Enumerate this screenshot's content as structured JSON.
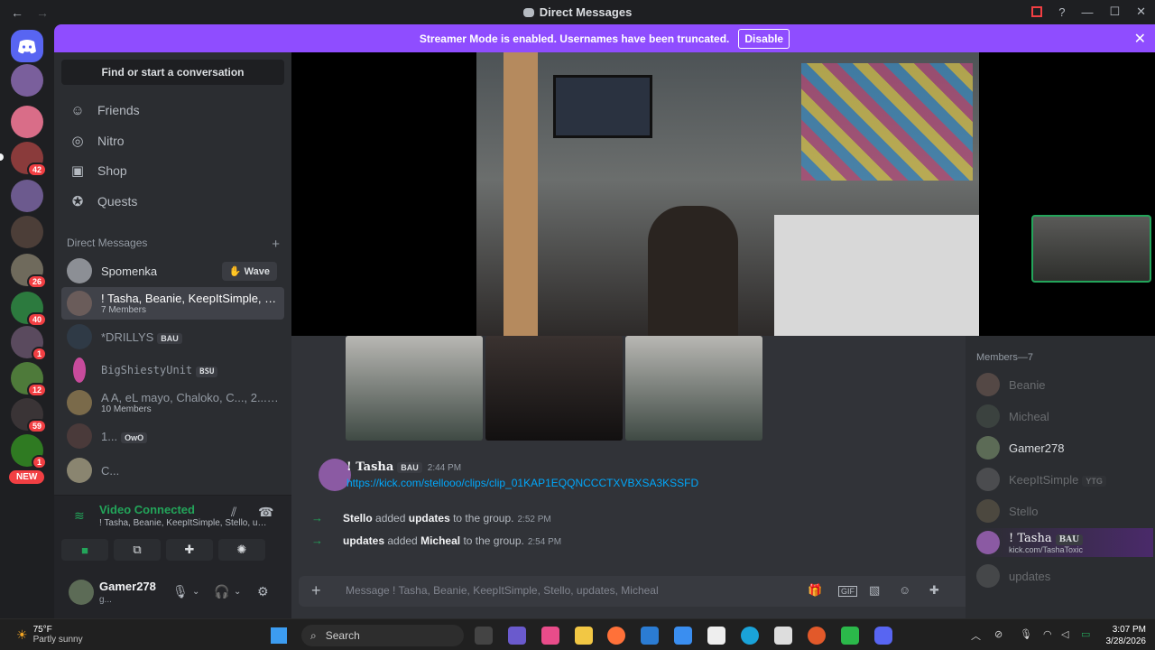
{
  "titlebar": {
    "title": "Direct Messages",
    "back": "←",
    "forward": "→"
  },
  "streamer": {
    "message": "Streamer Mode is enabled. Usernames have been truncated.",
    "disable_label": "Disable",
    "close": "✕"
  },
  "rail": {
    "badges": [
      "42",
      "26",
      "40",
      "1",
      "12",
      "59",
      "1"
    ],
    "new_label": "NEW"
  },
  "sidebar": {
    "find_label": "Find or start a conversation",
    "nav": [
      {
        "label": "Friends",
        "icon": "☺"
      },
      {
        "label": "Nitro",
        "icon": "◎"
      },
      {
        "label": "Shop",
        "icon": "▣"
      },
      {
        "label": "Quests",
        "icon": "✪"
      }
    ],
    "dm_header": "Direct Messages",
    "dm_add": "+",
    "dms": [
      {
        "name": "Spomenka",
        "sub": "",
        "tag": "",
        "wave": "Wave"
      },
      {
        "name": "! Tasha, Beanie, KeepItSimple, St...",
        "sub": "7 Members",
        "tag": ""
      },
      {
        "name": "*DRILLYS",
        "sub": "",
        "tag": "BAU"
      },
      {
        "name": "BigShiestyUnit",
        "sub": "",
        "tag": "BSU"
      },
      {
        "name": "A A, eL mayo, Chaloko, C..., 2..., ...",
        "sub": "10 Members",
        "tag": ""
      },
      {
        "name": "1...",
        "sub": "",
        "tag": "OwO"
      },
      {
        "name": "C...",
        "sub": "",
        "tag": ""
      }
    ]
  },
  "voice": {
    "title": "Video Connected",
    "subtitle": "! Tasha, Beanie, KeepItSimple, Stello, upd..."
  },
  "user": {
    "name": "Gamer278",
    "status": "g..."
  },
  "chat": {
    "message": {
      "author": "! Tasha",
      "tag": "BAU",
      "time": "2:44 PM",
      "link": "https://kick.com/stellooo/clips/clip_01KAP1EQQNCCCTXVBXSA3KSSFD"
    },
    "system": [
      {
        "actor": "Stello",
        "verb": "added",
        "target": "updates",
        "suffix": "to the group.",
        "time": "2:52 PM"
      },
      {
        "actor": "updates",
        "verb": "added",
        "target": "Micheal",
        "suffix": "to the group.",
        "time": "2:54 PM"
      }
    ],
    "composer_placeholder": "Message ! Tasha, Beanie, KeepItSimple, Stello, updates, Micheal"
  },
  "members": {
    "header": "Members—7",
    "list": [
      {
        "name": "Beanie",
        "sub": "",
        "tag": ""
      },
      {
        "name": "Micheal",
        "sub": "",
        "tag": ""
      },
      {
        "name": "Gamer278",
        "sub": "",
        "tag": ""
      },
      {
        "name": "KeepItSimple",
        "sub": "",
        "tag": "YTG"
      },
      {
        "name": "Stello",
        "sub": "",
        "tag": ""
      },
      {
        "name": "! Tasha",
        "sub": "kick.com/TashaToxic",
        "tag": "BAU"
      },
      {
        "name": "updates",
        "sub": "",
        "tag": ""
      }
    ]
  },
  "taskbar": {
    "temp": "75°F",
    "weather": "Partly sunny",
    "search": "Search",
    "time": "3:07 PM",
    "date": "3/28/2026"
  },
  "colors": {
    "accent": "#5865f2",
    "streamer": "#8f4dff",
    "online": "#23a55a",
    "link": "#00a8fc"
  }
}
